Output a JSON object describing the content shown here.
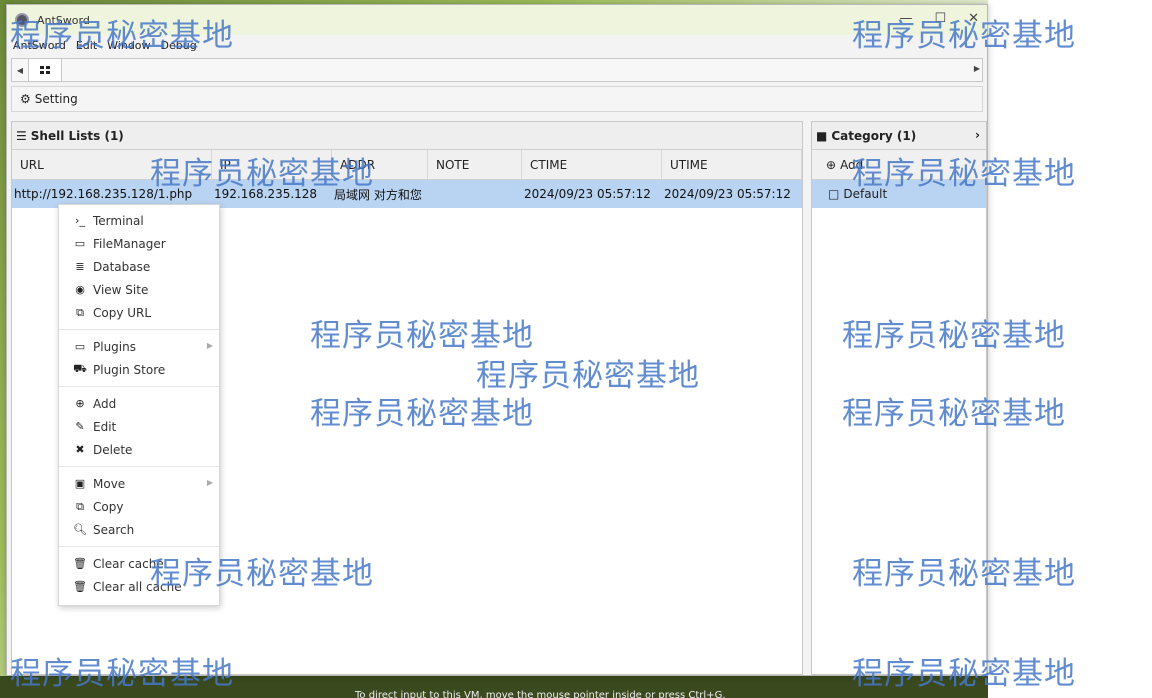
{
  "window": {
    "title": "AntSword",
    "controls": [
      "—",
      "☐",
      "✕"
    ]
  },
  "menubar": [
    "AntSword",
    "Edit",
    "Window",
    "Debug"
  ],
  "toolbar": {
    "setting_label": "Setting"
  },
  "shell_panel": {
    "title": "Shell Lists (1)",
    "columns": [
      "URL",
      "IP",
      "ADDR",
      "NOTE",
      "CTIME",
      "UTIME"
    ],
    "rows": [
      {
        "url": "http://192.168.235.128/1.php",
        "ip": "192.168.235.128",
        "addr": "局域网 对方和您",
        "note": "",
        "ctime": "2024/09/23 05:57:12",
        "utime": "2024/09/23 05:57:12"
      }
    ]
  },
  "category_panel": {
    "title": "Category (1)",
    "add_label": "Add",
    "items": [
      "Default"
    ]
  },
  "context_menu": {
    "groups": [
      [
        "Terminal",
        "FileManager",
        "Database",
        "View Site",
        "Copy URL"
      ],
      [
        "Plugins",
        "Plugin Store"
      ],
      [
        "Add",
        "Edit",
        "Delete"
      ],
      [
        "Move",
        "Copy",
        "Search"
      ],
      [
        "Clear cache",
        "Clear all cache"
      ]
    ]
  },
  "watermark": "程序员秘密基地",
  "vm_hint": "To direct input to this VM, move the mouse pointer inside or press Ctrl+G."
}
